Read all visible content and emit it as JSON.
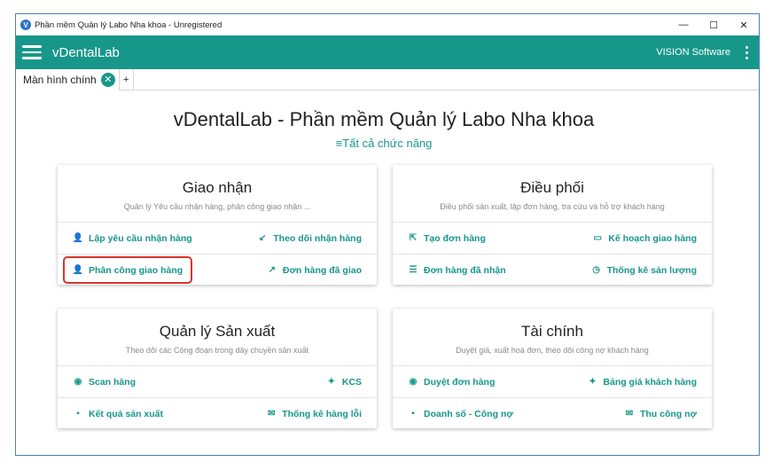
{
  "window": {
    "title": "Phần mềm Quản lý Labo Nha khoa - Unregistered",
    "app_icon_letter": "V",
    "minimize": "—",
    "maximize": "☐",
    "close": "✕"
  },
  "appbar": {
    "brand": "vDentalLab",
    "vendor": "VISION Software"
  },
  "tabs": {
    "active_label": "Màn hình chính",
    "close": "✕",
    "add": "+"
  },
  "main": {
    "title": "vDentalLab - Phần mềm Quản lý Labo Nha khoa",
    "all_functions": "≡Tất cả chức năng"
  },
  "cards": [
    {
      "title": "Giao nhận",
      "subtitle": "Quản lý Yêu cầu nhận hàng, phân công giao nhận ...",
      "links": [
        {
          "label": "Lập yêu cầu nhận hàng",
          "icon": "person-icon",
          "glyph": "👤"
        },
        {
          "label": "Theo dõi nhận hàng",
          "icon": "arrow-down-left-icon",
          "glyph": "↙"
        },
        {
          "label": "Phân công giao hàng",
          "icon": "person-icon",
          "glyph": "👤"
        },
        {
          "label": "Đơn hàng đã giao",
          "icon": "arrow-up-right-icon",
          "glyph": "↗"
        }
      ]
    },
    {
      "title": "Điều phối",
      "subtitle": "Điều phối sản xuất, lập đơn hàng, tra cứu và hỗ trợ khách hàng",
      "links": [
        {
          "label": "Tạo đơn hàng",
          "icon": "new-order-icon",
          "glyph": "⇱"
        },
        {
          "label": "Kế hoạch giao hàng",
          "icon": "monitor-icon",
          "glyph": "▭"
        },
        {
          "label": "Đơn hàng đã nhận",
          "icon": "list-icon",
          "glyph": "☰"
        },
        {
          "label": "Thống kê sản lượng",
          "icon": "clock-icon",
          "glyph": "◷"
        }
      ]
    },
    {
      "title": "Quản lý Sản xuất",
      "subtitle": "Theo dõi các Công đoạn trong dây chuyền sản xuất",
      "links": [
        {
          "label": "Scan hàng",
          "icon": "github-icon",
          "glyph": "◉"
        },
        {
          "label": "KCS",
          "icon": "twitter-icon",
          "glyph": "✦"
        },
        {
          "label": "Kết quả sản xuất",
          "icon": "comment-icon",
          "glyph": "▪"
        },
        {
          "label": "Thống kê hàng lỗi",
          "icon": "mail-icon",
          "glyph": "✉"
        }
      ]
    },
    {
      "title": "Tài chính",
      "subtitle": "Duyệt giá, xuất hoá đơn, theo dõi công nợ khách hàng",
      "links": [
        {
          "label": "Duyệt đơn hàng",
          "icon": "github-icon",
          "glyph": "◉"
        },
        {
          "label": "Bảng giá khách hàng",
          "icon": "twitter-icon",
          "glyph": "✦"
        },
        {
          "label": "Doanh số - Công nợ",
          "icon": "comment-icon",
          "glyph": "▪"
        },
        {
          "label": "Thu công nợ",
          "icon": "mail-icon",
          "glyph": "✉"
        }
      ]
    }
  ],
  "colors": {
    "accent": "#17978a",
    "highlight": "#d9342b"
  }
}
